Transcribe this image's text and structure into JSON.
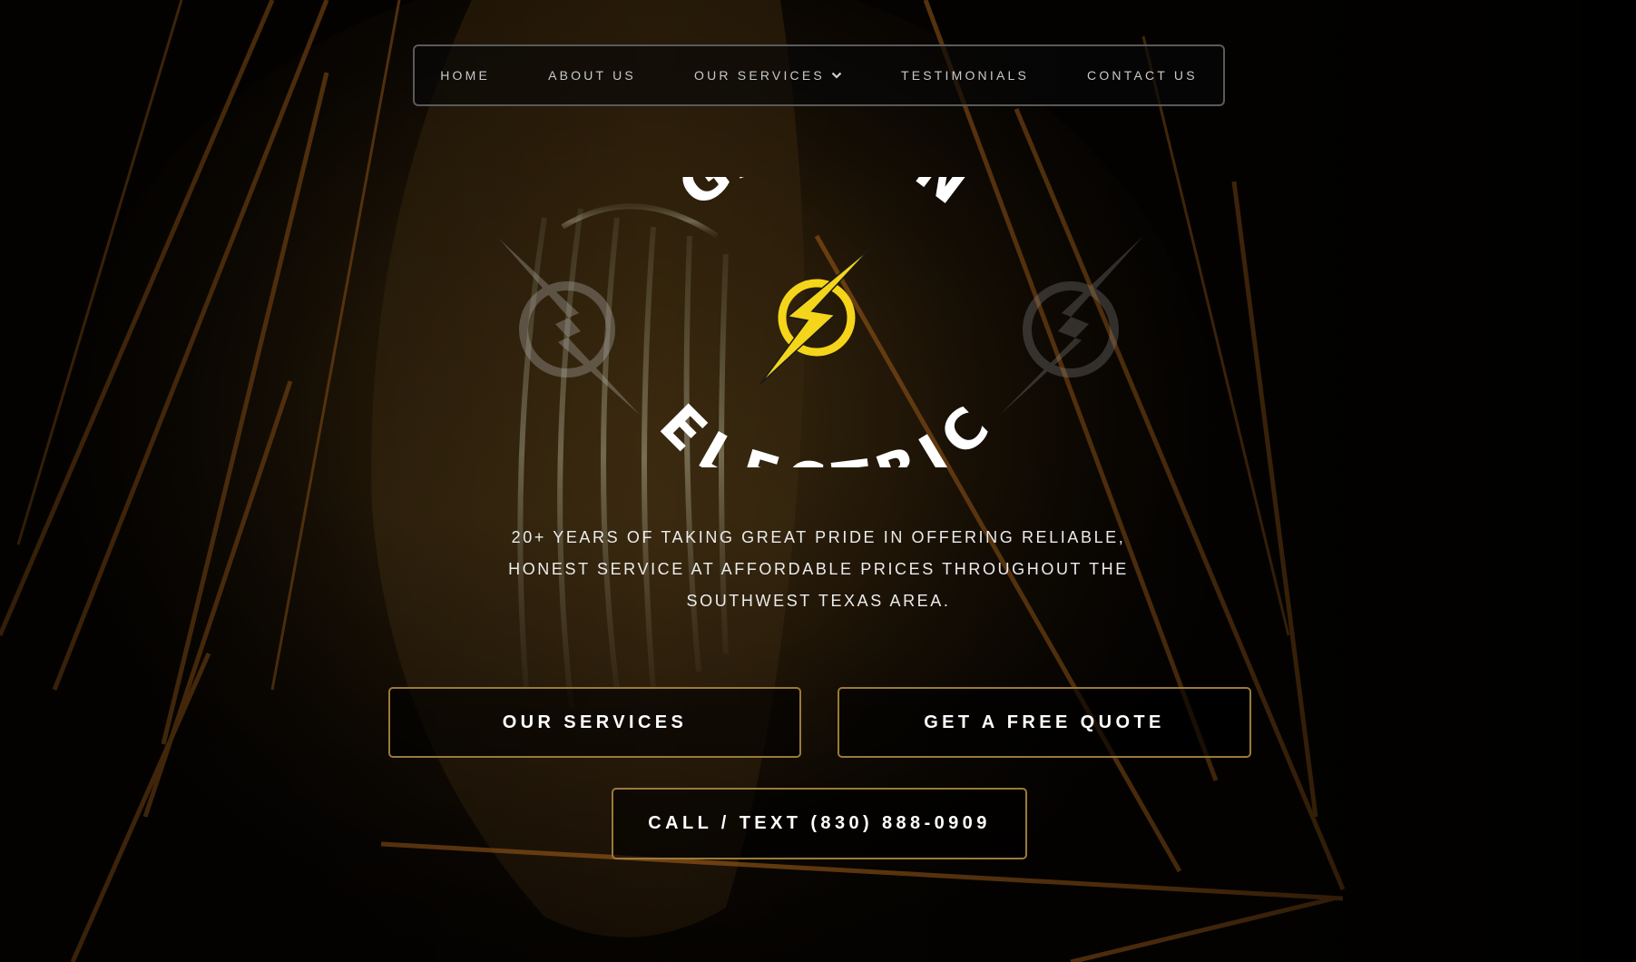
{
  "nav": {
    "items": [
      {
        "label": "HOME"
      },
      {
        "label": "ABOUT US"
      },
      {
        "label": "OUR SERVICES",
        "has_dropdown": true
      },
      {
        "label": "TESTIMONIALS"
      },
      {
        "label": "CONTACT US"
      }
    ]
  },
  "logo": {
    "top_text": "GALVAN",
    "bottom_text": "ELECTRIC",
    "icon": "lightning-bolt-icon"
  },
  "tagline": {
    "lines": [
      "20+ YEARS OF TAKING GREAT PRIDE IN OFFERING RELIABLE,",
      "HONEST SERVICE AT AFFORDABLE PRICES THROUGHOUT THE",
      "SOUTHWEST TEXAS AREA."
    ]
  },
  "buttons": {
    "services": "OUR SERVICES",
    "quote": "GET A FREE QUOTE",
    "call": "CALL / TEXT (830) 888-0909"
  },
  "colors": {
    "accent_gold": "#9a7a3a",
    "bolt_yellow": "#f5d51a",
    "text_light": "#ececec"
  }
}
